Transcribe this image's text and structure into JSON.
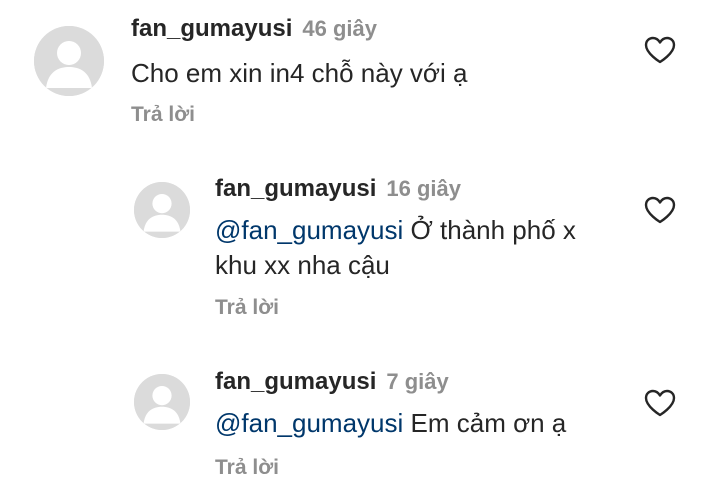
{
  "comments": [
    {
      "username": "fan_gumayusi",
      "time": "46 giây",
      "mention": "",
      "text": "Cho em xin in4 chỗ này với ạ",
      "reply_label": "Trả lời"
    },
    {
      "username": "fan_gumayusi",
      "time": "16 giây",
      "mention": "@fan_gumayusi",
      "text": " Ở thành phố x khu xx nha cậu",
      "reply_label": "Trả lời"
    },
    {
      "username": "fan_gumayusi",
      "time": "7 giây",
      "mention": "@fan_gumayusi",
      "text": " Em cảm ơn ạ",
      "reply_label": "Trả lời"
    }
  ],
  "icons": {
    "avatar": "default-avatar-icon",
    "like": "heart-outline-icon"
  },
  "colors": {
    "username": "#262626",
    "secondary": "#8e8e8e",
    "mention": "#00376b",
    "avatar_bg": "#dbdbdb"
  }
}
